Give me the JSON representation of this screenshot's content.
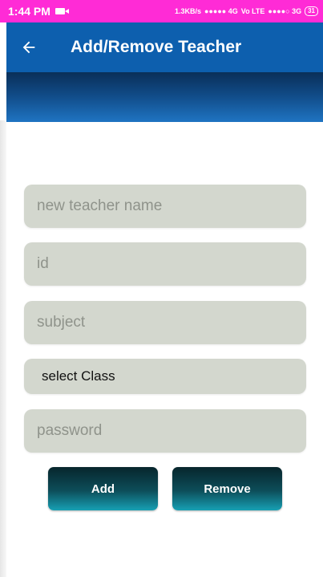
{
  "status_bar": {
    "time": "1:44 PM",
    "network_speed": "1.3KB/s",
    "signal_1": "●●●●● 4G",
    "volte": "Vo LTE",
    "signal_2": "●●●●○ 3G",
    "battery": "31"
  },
  "app_bar": {
    "title": "Add/Remove Teacher",
    "back_icon": "arrow-back-icon"
  },
  "form": {
    "name_placeholder": "new teacher name",
    "id_placeholder": "id",
    "subject_placeholder": "subject",
    "class_selected": "select Class",
    "password_placeholder": "password"
  },
  "buttons": {
    "add_label": "Add",
    "remove_label": "Remove"
  },
  "colors": {
    "status_bar": "#ff2bd6",
    "app_bar": "#0d5fae",
    "field_bg": "#d3d7ce",
    "button_dark": "#0d4e5a",
    "button_light": "#17a0b4"
  }
}
